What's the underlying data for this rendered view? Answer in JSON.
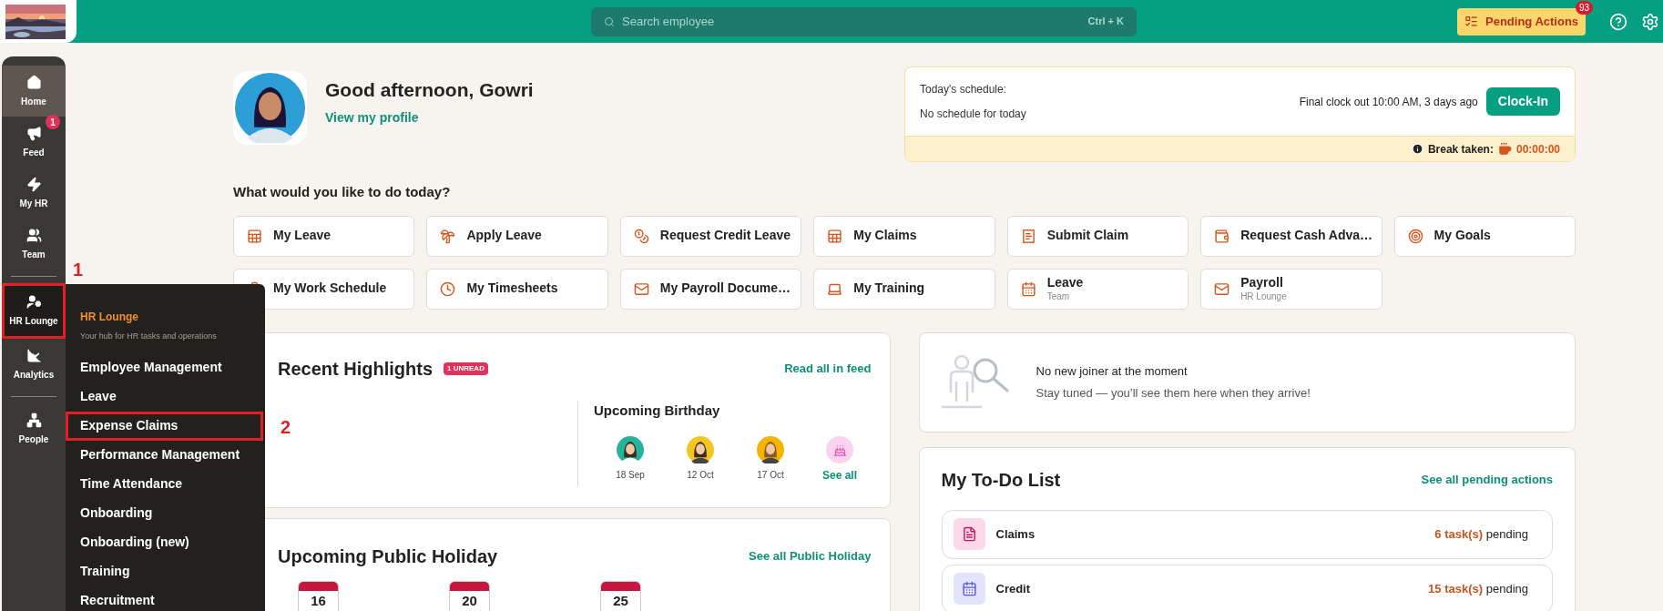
{
  "header": {
    "search": {
      "placeholder": "Search employee",
      "shortcut": "Ctrl + K"
    },
    "pending_actions": {
      "label": "Pending Actions",
      "count": "93"
    }
  },
  "sidebar": {
    "groups": [
      [
        {
          "label": "Home",
          "selected": true,
          "expanded": false
        },
        {
          "label": "Feed",
          "selected": false,
          "expanded": false,
          "badge": "1"
        },
        {
          "label": "My HR",
          "selected": false,
          "expanded": false
        },
        {
          "label": "Team",
          "selected": false,
          "expanded": false
        }
      ],
      [
        {
          "label": "HR Lounge",
          "selected": false,
          "expanded": true,
          "callout": "1"
        },
        {
          "label": "Analytics",
          "selected": false,
          "expanded": false
        }
      ],
      [
        {
          "label": "People",
          "selected": false,
          "expanded": false
        }
      ]
    ]
  },
  "flyout": {
    "title": "HR Lounge",
    "subtitle": "Your hub for HR tasks and operations",
    "items": [
      {
        "label": "Employee Management"
      },
      {
        "label": "Leave"
      },
      {
        "label": "Expense Claims",
        "callout": "2"
      },
      {
        "label": "Performance Management"
      },
      {
        "label": "Time Attendance"
      },
      {
        "label": "Onboarding"
      },
      {
        "label": "Onboarding (new)"
      },
      {
        "label": "Training"
      },
      {
        "label": "Recruitment"
      }
    ]
  },
  "greeting": {
    "title": "Good afternoon, Gowri",
    "link": "View my profile"
  },
  "schedule": {
    "label": "Today's schedule:",
    "value": "No schedule for today",
    "last_clock": "Final clock out 10:00 AM, 3 days ago",
    "button": "Clock-In",
    "break_label": "Break taken:",
    "break_time": "00:00:00"
  },
  "quick_actions": {
    "title": "What would you like to do today?",
    "items": [
      {
        "label": "My Leave"
      },
      {
        "label": "Apply Leave"
      },
      {
        "label": "Request Credit Leave"
      },
      {
        "label": "My Claims"
      },
      {
        "label": "Submit Claim"
      },
      {
        "label": "Request Cash Adva…"
      },
      {
        "label": "My Goals"
      },
      {
        "label": "My Work Schedule"
      },
      {
        "label": "My Timesheets"
      },
      {
        "label": "My Payroll Docume…"
      },
      {
        "label": "My Training"
      },
      {
        "label": "Leave",
        "sublabel": "Team"
      },
      {
        "label": "Payroll",
        "sublabel": "HR Lounge"
      }
    ]
  },
  "highlights": {
    "title": "Recent Highlights",
    "badge": "1 UNREAD",
    "link": "Read all in feed",
    "birthdays": {
      "title": "Upcoming Birthday",
      "people": [
        {
          "date": "18 Sep"
        },
        {
          "date": "12 Oct"
        },
        {
          "date": "17 Oct"
        }
      ],
      "see_all": "See all"
    }
  },
  "new_joiners": {
    "title": "No new joiner at the moment",
    "subtitle": "Stay tuned — you’ll see them here when they arrive!"
  },
  "public_holidays": {
    "title": "Upcoming Public Holiday",
    "link": "See all Public Holiday",
    "days": [
      {
        "day": "16"
      },
      {
        "day": "20"
      },
      {
        "day": "25"
      }
    ]
  },
  "todo": {
    "title": "My To-Do List",
    "link": "See all pending actions",
    "items": [
      {
        "label": "Claims",
        "count": "6 task(s)",
        "suffix": "pending"
      },
      {
        "label": "Credit",
        "count": "15 task(s)",
        "suffix": "pending"
      }
    ]
  }
}
